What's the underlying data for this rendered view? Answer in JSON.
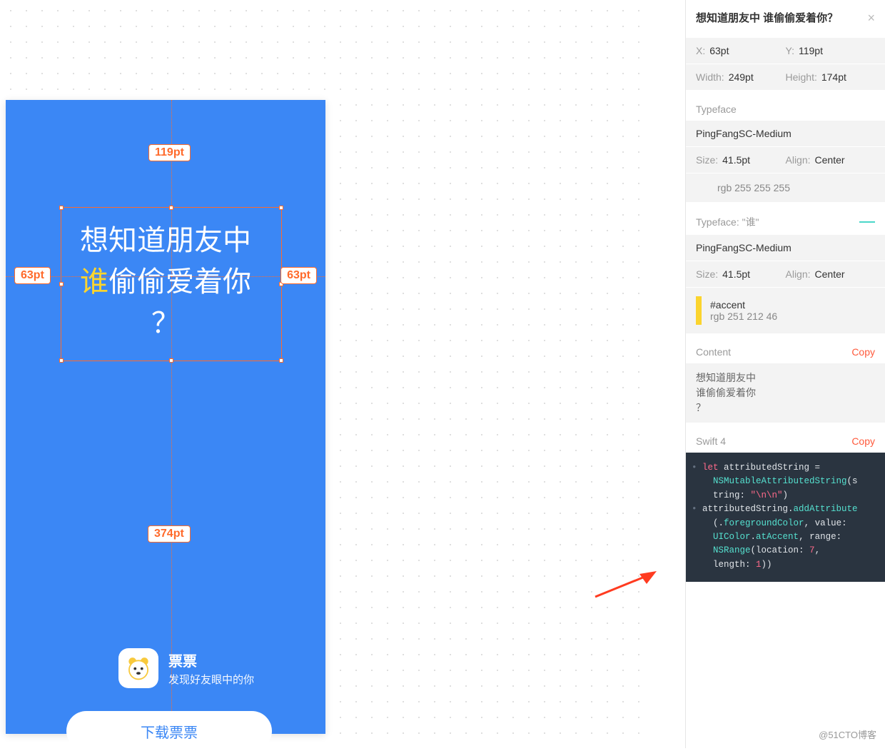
{
  "inspector": {
    "title": "想知道朋友中 谁偷偷爱着你？",
    "position": {
      "x_label": "X:",
      "x_value": "63pt",
      "y_label": "Y:",
      "y_value": "119pt"
    },
    "size": {
      "w_label": "Width:",
      "w_value": "249pt",
      "h_label": "Height:",
      "h_value": "174pt"
    },
    "typeface1": {
      "section": "Typeface",
      "font": "PingFangSC-Medium",
      "size_label": "Size:",
      "size_value": "41.5pt",
      "align_label": "Align:",
      "align_value": "Center",
      "color_text": "rgb 255 255 255"
    },
    "typeface2": {
      "section": "Typeface: \"谁\"",
      "font": "PingFangSC-Medium",
      "size_label": "Size:",
      "size_value": "41.5pt",
      "align_label": "Align:",
      "align_value": "Center",
      "color_name": "#accent",
      "color_text": "rgb 251 212 46"
    },
    "content": {
      "section": "Content",
      "copy": "Copy",
      "text": "想知道朋友中\n谁偷偷爱着你\n？"
    },
    "code": {
      "section": "Swift 4",
      "copy": "Copy",
      "l1_kw": "let",
      "l1_rest": " attributedString =",
      "l2_type": "NSMutableAttributedString",
      "l2_rest": "(s",
      "l3_a": "tring: ",
      "l3_str": "\"\\n\\n\"",
      "l3_b": ")",
      "l4_a": "attributedString.",
      "l4_fn": "addAttribute",
      "l5_a": "(.",
      "l5_prop": "foregroundColor",
      "l5_b": ", value:",
      "l6_type": "UIColor",
      "l6_dot": ".",
      "l6_prop": "atAccent",
      "l6_b": ", range:",
      "l7_type": "NSRange",
      "l7_a": "(location: ",
      "l7_num1": "7",
      "l7_b": ",",
      "l8_a": "length: ",
      "l8_num": "1",
      "l8_b": "))"
    }
  },
  "canvas": {
    "measurements": {
      "top": "119pt",
      "left": "63pt",
      "right": "63pt",
      "bottom": "374pt"
    },
    "title_line1": "想知道朋友中",
    "title_accent": "谁",
    "title_line2_rest": "偷偷爱着你",
    "title_line3": "？",
    "app_name": "票票",
    "app_sub": "发现好友眼中的你",
    "download": "下载票票"
  },
  "watermark": "@51CTO博客"
}
